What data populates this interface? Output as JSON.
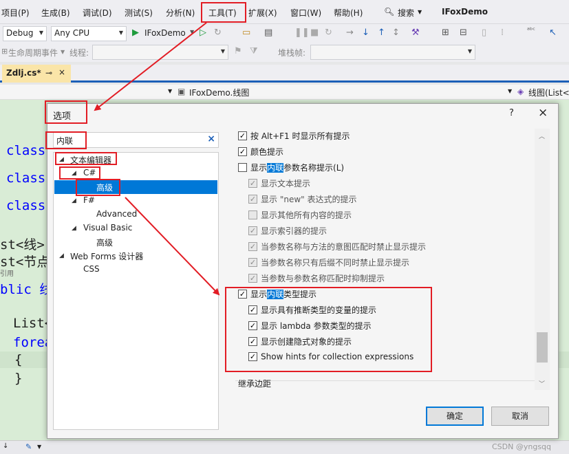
{
  "menubar": {
    "items": [
      "项目(P)",
      "生成(B)",
      "调试(D)",
      "测试(S)",
      "分析(N)",
      "工具(T)",
      "扩展(X)",
      "窗口(W)",
      "帮助(H)"
    ],
    "search_label": "搜索",
    "app_name": "IFoxDemo"
  },
  "toolbar": {
    "config": "Debug",
    "platform": "Any CPU",
    "run_target": "IFoxDemo",
    "lifecycle_label": "生命周期事件",
    "thread_label": "线程:",
    "stackframe_label": "堆栈帧:"
  },
  "document_tab": {
    "name": "Zdlj.cs*",
    "pin": "⊸",
    "close": "×"
  },
  "navbar": {
    "project": "IFoxDemo.线图",
    "member": "线图(List<"
  },
  "editor": {
    "lines": [
      "class",
      "class",
      "class",
      "st<线>",
      "st<节点",
      "引用",
      "blic 线",
      "List<",
      "forea",
      "{",
      "}"
    ]
  },
  "dialog": {
    "title": "选项",
    "help": "?",
    "close": "×",
    "search_value": "内联",
    "search_clear": "×",
    "tree": [
      {
        "label": "文本编辑器"
      },
      {
        "label": "C#"
      },
      {
        "label": "高级"
      },
      {
        "label": "F#"
      },
      {
        "label": "Advanced"
      },
      {
        "label": "Visual Basic"
      },
      {
        "label": "高级"
      },
      {
        "label": "Web Forms 设计器"
      },
      {
        "label": "CSS"
      }
    ],
    "options": [
      {
        "pre": "按 Alt+F1 时显示所有提示",
        "hl": "",
        "post": "",
        "checked": true,
        "enabled": true
      },
      {
        "pre": "颜色提示",
        "hl": "",
        "post": "",
        "checked": true,
        "enabled": true
      },
      {
        "pre": "显示",
        "hl": "内联",
        "post": "参数名称提示(L)",
        "checked": false,
        "enabled": true
      },
      {
        "pre": "显示文本提示",
        "hl": "",
        "post": "",
        "checked": true,
        "enabled": false
      },
      {
        "pre": "显示 \"new\" 表达式的提示",
        "hl": "",
        "post": "",
        "checked": true,
        "enabled": false
      },
      {
        "pre": "显示其他所有内容的提示",
        "hl": "",
        "post": "",
        "checked": false,
        "enabled": false
      },
      {
        "pre": "显示索引器的提示",
        "hl": "",
        "post": "",
        "checked": true,
        "enabled": false
      },
      {
        "pre": "当参数名称与方法的意图匹配时禁止显示提示",
        "hl": "",
        "post": "",
        "checked": true,
        "enabled": false
      },
      {
        "pre": "当参数名称只有后缀不同时禁止显示提示",
        "hl": "",
        "post": "",
        "checked": true,
        "enabled": false
      },
      {
        "pre": "当参数与参数名称匹配时抑制提示",
        "hl": "",
        "post": "",
        "checked": true,
        "enabled": false
      },
      {
        "pre": "显示",
        "hl": "内联",
        "post": "类型提示",
        "checked": true,
        "enabled": true
      },
      {
        "pre": "显示具有推断类型的变量的提示",
        "hl": "",
        "post": "",
        "checked": true,
        "enabled": true
      },
      {
        "pre": "显示 lambda 参数类型的提示",
        "hl": "",
        "post": "",
        "checked": true,
        "enabled": true
      },
      {
        "pre": "显示创建隐式对象的提示",
        "hl": "",
        "post": "",
        "checked": true,
        "enabled": true
      },
      {
        "pre": "Show hints for collection expressions",
        "hl": "",
        "post": "",
        "checked": true,
        "enabled": true
      }
    ],
    "footer_section": "继承边距",
    "ok": "确定",
    "cancel": "取消"
  },
  "watermark": "CSDN @yngsqq",
  "colors": {
    "annotation": "#e21c24",
    "selection": "#0078d7",
    "editor_bg": "#d9ecd6",
    "tab_active": "#fae5a8"
  }
}
